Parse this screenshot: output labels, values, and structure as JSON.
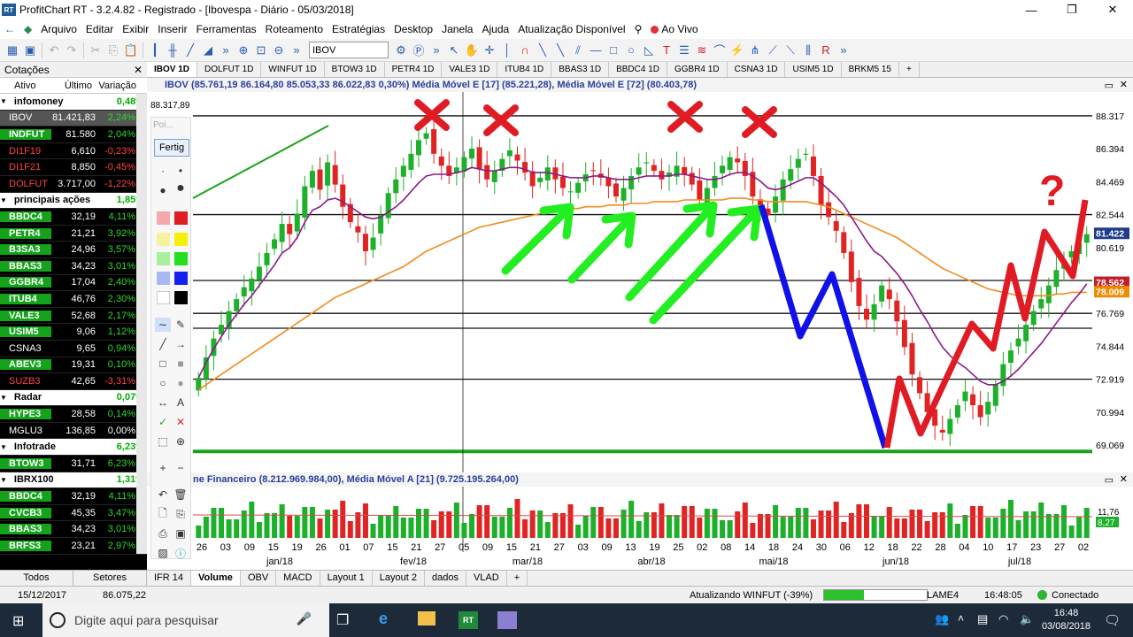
{
  "window": {
    "title": "ProfitChart RT - 3.2.4.82 - Registrado - [Ibovespa - Diário - 05/03/2018]",
    "app_badge": "RT",
    "min": "—",
    "max": "❐",
    "close": "✕"
  },
  "menu": [
    "Arquivo",
    "Editar",
    "Exibir",
    "Inserir",
    "Ferramentas",
    "Roteamento",
    "Estratégias",
    "Desktop",
    "Janela",
    "Ajuda",
    "Atualização Disponível"
  ],
  "menu_live": "Ao Vivo",
  "toolbar": {
    "symbol_value": "IBOV"
  },
  "quotes": {
    "title": "Cotações",
    "close": "✕",
    "cols": {
      "asset": "Ativo",
      "last": "Último",
      "change": "Variação"
    },
    "rows": [
      {
        "type": "group",
        "name": "infomoney",
        "chg": "0,48%"
      },
      {
        "type": "row",
        "name": "IBOV",
        "last": "81.421,83",
        "chg": "2,24%",
        "dir": "up",
        "hl": "none",
        "selected": true
      },
      {
        "type": "row",
        "name": "INDFUT",
        "last": "81.580",
        "chg": "2,04%",
        "dir": "up",
        "hl": "up"
      },
      {
        "type": "row",
        "name": "DI1F19",
        "last": "6,610",
        "chg": "-0,23%",
        "dir": "dn",
        "hl": "dn"
      },
      {
        "type": "row",
        "name": "DI1F21",
        "last": "8,850",
        "chg": "-0,45%",
        "dir": "dn",
        "hl": "dn"
      },
      {
        "type": "row",
        "name": "DOLFUT",
        "last": "3.717,00",
        "chg": "-1,22%",
        "dir": "dn",
        "hl": "dn"
      },
      {
        "type": "group",
        "name": "principais ações",
        "chg": "1,85%"
      },
      {
        "type": "row",
        "name": "BBDC4",
        "last": "32,19",
        "chg": "4,11%",
        "dir": "up",
        "hl": "up"
      },
      {
        "type": "row",
        "name": "PETR4",
        "last": "21,21",
        "chg": "3,92%",
        "dir": "up",
        "hl": "up"
      },
      {
        "type": "row",
        "name": "B3SA3",
        "last": "24,96",
        "chg": "3,57%",
        "dir": "up",
        "hl": "up"
      },
      {
        "type": "row",
        "name": "BBAS3",
        "last": "34,23",
        "chg": "3,01%",
        "dir": "up",
        "hl": "up"
      },
      {
        "type": "row",
        "name": "GGBR4",
        "last": "17,04",
        "chg": "2,40%",
        "dir": "up",
        "hl": "up"
      },
      {
        "type": "row",
        "name": "ITUB4",
        "last": "46,76",
        "chg": "2,30%",
        "dir": "up",
        "hl": "up"
      },
      {
        "type": "row",
        "name": "VALE3",
        "last": "52,68",
        "chg": "2,17%",
        "dir": "up",
        "hl": "up"
      },
      {
        "type": "row",
        "name": "USIM5",
        "last": "9,06",
        "chg": "1,12%",
        "dir": "up",
        "hl": "up"
      },
      {
        "type": "row",
        "name": "CSNA3",
        "last": "9,65",
        "chg": "0,94%",
        "dir": "up",
        "hl": "none"
      },
      {
        "type": "row",
        "name": "ABEV3",
        "last": "19,31",
        "chg": "0,10%",
        "dir": "up",
        "hl": "up"
      },
      {
        "type": "row",
        "name": "SUZB3",
        "last": "42,65",
        "chg": "-3,31%",
        "dir": "dn",
        "hl": "dn"
      },
      {
        "type": "group",
        "name": "Radar",
        "chg": "0,07%"
      },
      {
        "type": "row",
        "name": "HYPE3",
        "last": "28,58",
        "chg": "0,14%",
        "dir": "up",
        "hl": "up"
      },
      {
        "type": "row",
        "name": "MGLU3",
        "last": "136,85",
        "chg": "0,00%",
        "dir": "flat",
        "hl": "none"
      },
      {
        "type": "group",
        "name": "Infotrade",
        "chg": "6,23%"
      },
      {
        "type": "row",
        "name": "BTOW3",
        "last": "31,71",
        "chg": "6,23%",
        "dir": "up",
        "hl": "up"
      },
      {
        "type": "group",
        "name": "IBRX100",
        "chg": "1,31%"
      },
      {
        "type": "row",
        "name": "BBDC4",
        "last": "32,19",
        "chg": "4,11%",
        "dir": "up",
        "hl": "up"
      },
      {
        "type": "row",
        "name": "CVCB3",
        "last": "45,35",
        "chg": "3,47%",
        "dir": "up",
        "hl": "up"
      },
      {
        "type": "row",
        "name": "BBAS3",
        "last": "34,23",
        "chg": "3,01%",
        "dir": "up",
        "hl": "up"
      },
      {
        "type": "row",
        "name": "BRFS3",
        "last": "23,21",
        "chg": "2,97%",
        "dir": "up",
        "hl": "up"
      }
    ],
    "tabs": [
      "Todos",
      "Setores"
    ]
  },
  "chart_tabs": [
    "IBOV 1D",
    "DOLFUT 1D",
    "WINFUT 1D",
    "BTOW3 1D",
    "PETR4 1D",
    "VALE3 1D",
    "ITUB4 1D",
    "BBAS3 1D",
    "BBDC4 1D",
    "GGBR4 1D",
    "CSNA3 1D",
    "USIM5 1D",
    "BRKM5 15"
  ],
  "chart_tab_add": "+",
  "chart_header": "IBOV (85.761,19  86.164,80  85.053,33  86.022,83  0,30%)   Média Móvel E [17] (85.221,28), Média Móvel E [72] (80.403,78)",
  "cursor_price": "88.317,89",
  "fertig_label": "Fertig",
  "tool_placeholder": "Poi...",
  "volume_header": "ne Financeiro (8.212.969.984,00), Média Móvel A [21] (9.725.195.264,00)",
  "volume_axis": [
    "11,76",
    "8,27"
  ],
  "bottom_tabs": [
    "IFR 14",
    "Volume",
    "OBV",
    "MACD",
    "Layout 1",
    "Layout 2",
    "dados",
    "VLAD"
  ],
  "bottom_tab_add": "+",
  "status": {
    "left_date": "15/12/2017",
    "left_value": "86.075,22",
    "update": "Atualizando WINFUT (-39%)",
    "progress": 0.39,
    "server": "LAME4",
    "time": "16:48:05",
    "connected": "Conectado"
  },
  "taskbar": {
    "search": "Digite aqui para pesquisar",
    "time": "16:48",
    "date": "03/08/2018"
  },
  "chart_data": {
    "type": "candlestick",
    "title": "IBOV",
    "y_ticks": [
      88.317,
      86.394,
      84.469,
      82.544,
      80.619,
      78.694,
      76.769,
      74.844,
      72.919,
      70.994,
      69.069
    ],
    "y_tick_labels": [
      "88.317",
      "86.394",
      "84.469",
      "82.544",
      "80.619",
      "",
      "76.769",
      "74.844",
      "72.919",
      "70.994",
      "69.069"
    ],
    "ylim": [
      68.4,
      89.4
    ],
    "price_tags": [
      {
        "label": "81.422",
        "value": 81.422,
        "color": "#1f3b8c"
      },
      {
        "label": "78.562",
        "value": 78.562,
        "color": "#c0202a"
      },
      {
        "label": "78.009",
        "value": 78.009,
        "color": "#f08c00"
      }
    ],
    "horizontal_levels": [
      88.317,
      82.544,
      78.694,
      76.769,
      75.9,
      72.919
    ],
    "x_days": [
      "26",
      "03",
      "09",
      "15",
      "19",
      "26",
      "01",
      "07",
      "15",
      "21",
      "27",
      "05",
      "09",
      "15",
      "21",
      "27",
      "03",
      "09",
      "13",
      "19",
      "25",
      "02",
      "08",
      "14",
      "18",
      "24",
      "30",
      "06",
      "12",
      "18",
      "22",
      "28",
      "04",
      "10",
      "17",
      "23",
      "27",
      "02"
    ],
    "x_months": [
      "jan/18",
      "fev/18",
      "mar/18",
      "abr/18",
      "mai/18",
      "jun/18",
      "jul/18"
    ],
    "closes": [
      73.0,
      74.2,
      75.3,
      76.1,
      76.9,
      77.6,
      78.3,
      78.8,
      79.5,
      80.3,
      81.1,
      82.0,
      81.4,
      82.6,
      84.2,
      85.1,
      84.0,
      85.6,
      84.3,
      83.0,
      82.1,
      81.5,
      80.4,
      81.2,
      82.5,
      83.8,
      84.6,
      85.4,
      86.1,
      86.9,
      87.3,
      86.1,
      85.4,
      84.8,
      85.3,
      85.9,
      86.4,
      85.2,
      84.6,
      85.1,
      85.8,
      86.3,
      85.7,
      85.0,
      84.2,
      84.7,
      85.3,
      84.6,
      84.1,
      83.9,
      84.4,
      84.9,
      85.1,
      84.7,
      84.2,
      83.6,
      84.1,
      84.8,
      85.3,
      85.6,
      85.1,
      84.6,
      85.0,
      85.4,
      84.9,
      84.3,
      83.4,
      84.1,
      84.8,
      85.4,
      85.9,
      85.6,
      84.8,
      83.6,
      82.9,
      82.5,
      83.6,
      84.6,
      85.2,
      85.8,
      86.1,
      84.8,
      83.1,
      82.4,
      81.6,
      80.3,
      78.6,
      77.2,
      76.4,
      77.3,
      78.4,
      77.6,
      76.3,
      74.8,
      73.2,
      72.1,
      71.0,
      70.2,
      69.8,
      70.6,
      71.4,
      72.2,
      71.4,
      70.7,
      71.6,
      72.6,
      73.8,
      74.6,
      75.3,
      76.1,
      76.9,
      77.6,
      78.4,
      79.3,
      79.8,
      80.4,
      80.9,
      81.4
    ],
    "ema17": [
      73.0,
      73.9,
      74.7,
      75.4,
      76.1,
      76.7,
      77.3,
      77.8,
      78.4,
      79.0,
      79.6,
      80.3,
      80.6,
      81.2,
      82.1,
      82.8,
      83.0,
      83.4,
      83.5,
      83.3,
      83.0,
      82.7,
      82.4,
      82.3,
      82.4,
      82.7,
      83.0,
      83.4,
      83.9,
      84.4,
      84.8,
      84.9,
      84.9,
      84.9,
      85.0,
      85.1,
      85.3,
      85.2,
      85.1,
      85.1,
      85.2,
      85.3,
      85.3,
      85.2,
      85.0,
      85.0,
      85.0,
      84.9,
      84.8,
      84.7,
      84.7,
      84.7,
      84.8,
      84.8,
      84.7,
      84.6,
      84.6,
      84.6,
      84.7,
      84.8,
      84.8,
      84.8,
      84.8,
      84.9,
      84.9,
      84.8,
      84.7,
      84.6,
      84.6,
      84.7,
      84.9,
      85.0,
      85.0,
      84.8,
      84.5,
      84.1,
      84.0,
      84.1,
      84.3,
      84.5,
      84.7,
      84.7,
      84.4,
      84.0,
      83.6,
      83.1,
      82.4,
      81.7,
      81.0,
      80.4,
      80.1,
      79.6,
      79.1,
      78.5,
      77.8,
      77.0,
      76.3,
      75.5,
      74.8,
      74.3,
      73.9,
      73.6,
      73.2,
      72.8,
      72.6,
      72.6,
      72.8,
      73.1,
      73.5,
      74.0,
      74.5,
      75.0,
      75.6,
      76.2,
      76.8,
      77.4,
      77.9,
      78.5
    ],
    "ema72": [
      72.3,
      72.6,
      72.9,
      73.2,
      73.5,
      73.8,
      74.1,
      74.4,
      74.7,
      75.0,
      75.3,
      75.6,
      75.9,
      76.2,
      76.5,
      76.8,
      77.1,
      77.4,
      77.7,
      77.9,
      78.1,
      78.3,
      78.5,
      78.7,
      78.9,
      79.1,
      79.3,
      79.5,
      79.8,
      80.1,
      80.4,
      80.6,
      80.8,
      81.0,
      81.2,
      81.4,
      81.6,
      81.8,
      81.9,
      82.0,
      82.1,
      82.2,
      82.3,
      82.4,
      82.5,
      82.6,
      82.7,
      82.8,
      82.8,
      82.9,
      82.9,
      83.0,
      83.0,
      83.0,
      83.1,
      83.1,
      83.1,
      83.2,
      83.2,
      83.2,
      83.3,
      83.3,
      83.3,
      83.3,
      83.4,
      83.4,
      83.4,
      83.4,
      83.4,
      83.4,
      83.5,
      83.5,
      83.5,
      83.4,
      83.4,
      83.3,
      83.3,
      83.3,
      83.3,
      83.3,
      83.3,
      83.2,
      83.1,
      83.0,
      82.8,
      82.6,
      82.4,
      82.2,
      82.0,
      81.8,
      81.6,
      81.4,
      81.2,
      80.9,
      80.6,
      80.3,
      80.0,
      79.7,
      79.4,
      79.2,
      79.0,
      78.8,
      78.6,
      78.4,
      78.2,
      78.1,
      78.0,
      77.9,
      77.8,
      77.8,
      77.8,
      77.8,
      77.8,
      77.9,
      77.9,
      78.0,
      78.0,
      78.0
    ],
    "annotations": {
      "x_marks": 4,
      "up_arrows": 4,
      "question_mark": "?"
    }
  }
}
